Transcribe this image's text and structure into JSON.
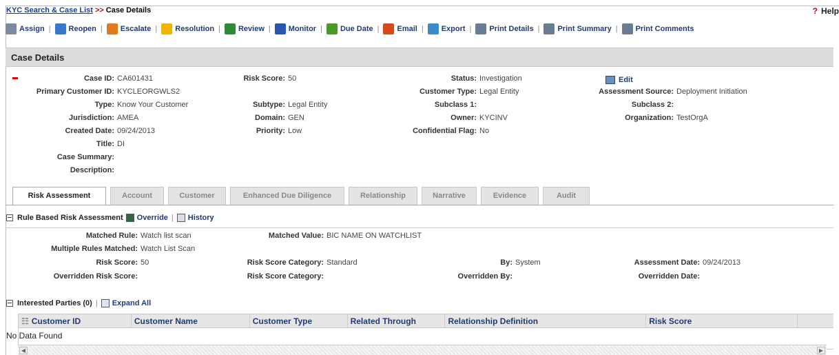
{
  "breadcrumb": {
    "link": "KYC Search & Case List",
    "separator": ">>",
    "current": "Case Details"
  },
  "help_label": "Help",
  "help_icon": "?",
  "toolbar": [
    {
      "label": "Assign",
      "icon": "assign-icon",
      "color": "#7a8aa0"
    },
    {
      "label": "Reopen",
      "icon": "reopen-icon",
      "color": "#3a78c9"
    },
    {
      "label": "Escalate",
      "icon": "escalate-icon",
      "color": "#e07a1a"
    },
    {
      "label": "Resolution",
      "icon": "resolution-icon",
      "color": "#f0b400"
    },
    {
      "label": "Review",
      "icon": "review-icon",
      "color": "#2e8b3a"
    },
    {
      "label": "Monitor",
      "icon": "monitor-icon",
      "color": "#2a55b0"
    },
    {
      "label": "Due Date",
      "icon": "due-date-icon",
      "color": "#4a9a2a"
    },
    {
      "label": "Email",
      "icon": "email-icon",
      "color": "#d84a1a"
    },
    {
      "label": "Export",
      "icon": "export-icon",
      "color": "#3a8ad0"
    },
    {
      "label": "Print Details",
      "icon": "printer-icon",
      "color": "#6a7b94"
    },
    {
      "label": "Print Summary",
      "icon": "printer-icon",
      "color": "#6a7b94"
    },
    {
      "label": "Print Comments",
      "icon": "printer-icon",
      "color": "#6a7b94"
    }
  ],
  "section_title": "Case Details",
  "edit_label": "Edit",
  "case": {
    "case_id_label": "Case ID:",
    "case_id": "CA601431",
    "primary_customer_id_label": "Primary Customer ID:",
    "primary_customer_id": "KYCLEORGWLS2",
    "type_label": "Type:",
    "type": "Know Your Customer",
    "jurisdiction_label": "Jurisdiction:",
    "jurisdiction": "AMEA",
    "created_date_label": "Created Date:",
    "created_date": "09/24/2013",
    "title_label": "Title:",
    "title": "DI",
    "case_summary_label": "Case Summary:",
    "case_summary": "",
    "description_label": "Description:",
    "description": "",
    "risk_score_label": "Risk Score:",
    "risk_score": "50",
    "subtype_label": "Subtype:",
    "subtype": "Legal Entity",
    "domain_label": "Domain:",
    "domain": "GEN",
    "priority_label": "Priority:",
    "priority": "Low",
    "status_label": "Status:",
    "status": "Investigation",
    "customer_type_label": "Customer Type:",
    "customer_type": "Legal Entity",
    "subclass1_label": "Subclass 1:",
    "subclass1": "",
    "owner_label": "Owner:",
    "owner": "KYCINV",
    "confidential_flag_label": "Confidential Flag:",
    "confidential_flag": "No",
    "assessment_source_label": "Assessment Source:",
    "assessment_source": "Deployment Initiation",
    "subclass2_label": "Subclass 2:",
    "subclass2": "",
    "organization_label": "Organization:",
    "organization": "TestOrgA"
  },
  "tabs": [
    {
      "label": "Risk Assessment",
      "active": true
    },
    {
      "label": "Account"
    },
    {
      "label": "Customer"
    },
    {
      "label": "Enhanced Due Diligence"
    },
    {
      "label": "Relationship"
    },
    {
      "label": "Narrative"
    },
    {
      "label": "Evidence"
    },
    {
      "label": "Audit"
    }
  ],
  "risk_assessment": {
    "title": "Rule Based Risk Assessment",
    "override_label": "Override",
    "history_label": "History",
    "matched_rule_label": "Matched Rule:",
    "matched_rule": "Watch list scan",
    "matched_value_label": "Matched Value:",
    "matched_value": "BIC NAME ON WATCHLIST",
    "multiple_rules_label": "Multiple Rules Matched:",
    "multiple_rules": "Watch List Scan",
    "risk_score_label": "Risk Score:",
    "risk_score": "50",
    "risk_score_category_label": "Risk Score Category:",
    "risk_score_category": "Standard",
    "by_label": "By:",
    "by": "System",
    "assessment_date_label": "Assessment Date:",
    "assessment_date": "09/24/2013",
    "overridden_risk_score_label": "Overridden Risk Score:",
    "overridden_risk_score": "",
    "overridden_category_label": "Risk Score Category:",
    "overridden_category": "",
    "overridden_by_label": "Overridden By:",
    "overridden_by": "",
    "overridden_date_label": "Overridden Date:",
    "overridden_date": ""
  },
  "interested_parties": {
    "title": "Interested Parties (0)",
    "expand_all_label": "Expand All",
    "columns": [
      "Customer ID",
      "Customer Name",
      "Customer Type",
      "Related Through",
      "Relationship Definition",
      "Risk Score"
    ],
    "empty_text": "No Data Found"
  }
}
